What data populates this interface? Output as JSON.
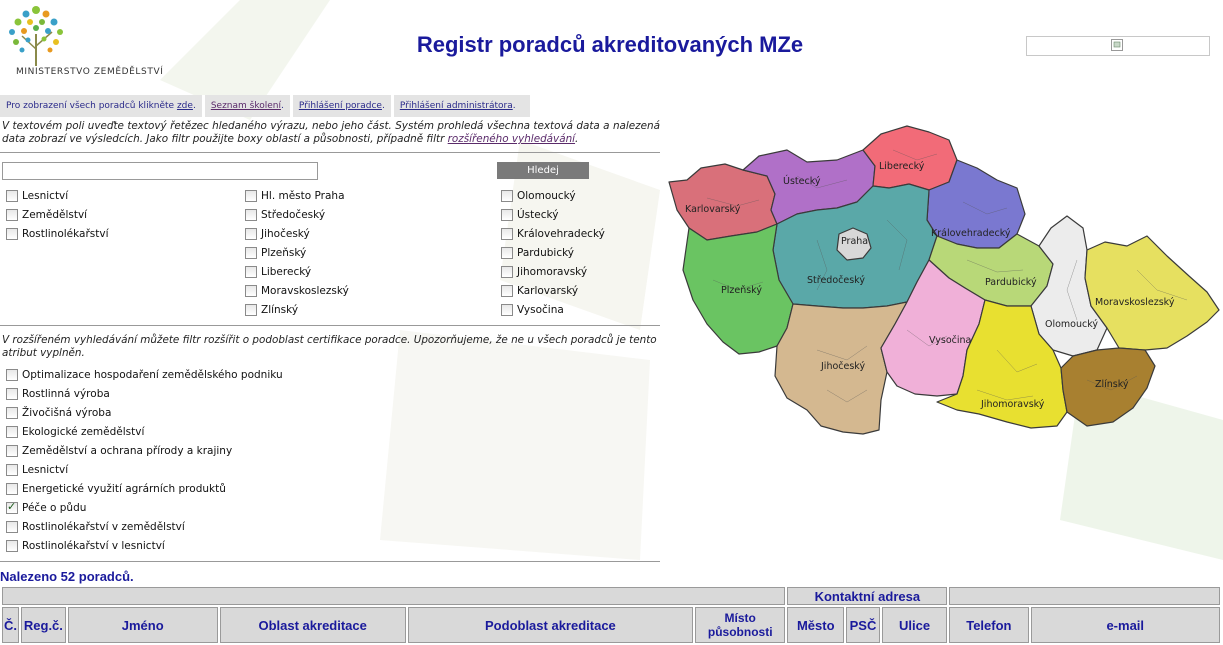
{
  "header": {
    "title": "Registr poradců akreditovaných MZe",
    "logo_text": "MINISTERSTVO ZEMĚDĚLSTVÍ"
  },
  "nav": {
    "all_prefix": "Pro zobrazení všech poradců klikněte ",
    "all_link": "zde",
    "training": "Seznam školení",
    "advisor_login": "Přihlášení poradce",
    "admin_login": "Přihlášení administrátora",
    "dot": "."
  },
  "intro": {
    "text": "V textovém poli uveďte textový řetězec hledaného výrazu, nebo jeho část. Systém prohledá všechna textová data a nalezená data zobrazí ve výsledcích. Jako filtr použijte boxy oblastí a působnosti, případně filtr ",
    "link": "rozšířeného vyhledávání",
    "suffix": "."
  },
  "search": {
    "value": "",
    "button": "Hledej"
  },
  "areas": [
    "Lesnictví",
    "Zemědělství",
    "Rostlinolékařství"
  ],
  "regions_col1": [
    "Hl. město Praha",
    "Středočeský",
    "Jihočeský",
    "Plzeňský",
    "Liberecký",
    "Moravskoslezský",
    "Zlínský"
  ],
  "regions_col2": [
    "Olomoucký",
    "Ústecký",
    "Královehradecký",
    "Pardubický",
    "Jihomoravský",
    "Karlovarský",
    "Vysočina"
  ],
  "extended": {
    "info": "V rozšířeném vyhledávání můžete filtr rozšířit o podoblast certifikace poradce. Upozorňujeme, že ne u všech poradců je tento atribut vyplněn.",
    "subareas": [
      {
        "label": "Optimalizace hospodaření zemědělského podniku",
        "checked": false
      },
      {
        "label": "Rostlinná výroba",
        "checked": false
      },
      {
        "label": "Živočišná výroba",
        "checked": false
      },
      {
        "label": "Ekologické zemědělství",
        "checked": false
      },
      {
        "label": "Zemědělství a ochrana přírody a krajiny",
        "checked": false
      },
      {
        "label": "Lesnictví",
        "checked": false
      },
      {
        "label": "Energetické využití agrárních produktů",
        "checked": false
      },
      {
        "label": "Péče o půdu",
        "checked": true
      },
      {
        "label": "Rostlinolékařství v zemědělství",
        "checked": false
      },
      {
        "label": "Rostlinolékařství v lesnictví",
        "checked": false
      }
    ]
  },
  "results": {
    "count_text": "Nalezeno 52 poradců.",
    "group_header": "Kontaktní adresa",
    "columns": [
      "Č.",
      "Reg.č.",
      "Jméno",
      "Oblast akreditace",
      "Podoblast akreditace",
      "Místo působnosti",
      "Město",
      "PSČ",
      "Ulice",
      "Telefon",
      "e-mail"
    ]
  },
  "map_labels": {
    "liberecky": "Liberecký",
    "ustecky": "Ústecký",
    "karlovarsky": "Karlovarský",
    "praha": "Praha",
    "kralovehradecky": "Královehradecký",
    "stredocesky": "Středočeský",
    "plzensky": "Plzeňský",
    "pardubicky": "Pardubický",
    "moravskoslezsky": "Moravskoslezský",
    "olomoucky": "Olomoucký",
    "vysocina": "Vysočina",
    "jihocesky": "Jihočeský",
    "zlinsky": "Zlínský",
    "jihomoravsky": "Jihomoravský"
  },
  "colors": {
    "title": "#1a1a9c",
    "karlovarsky": "#d9707a",
    "ustecky": "#b070c8",
    "liberecky": "#f26b78",
    "kralovehradecky": "#7a78d0",
    "praha": "#d8d8d8",
    "stredocesky": "#5aa8a8",
    "plzensky": "#6ac462",
    "pardubicky": "#b8d878",
    "olomoucky": "#ececec",
    "moravskoslezsky": "#e6e060",
    "vysocina": "#f0b0d8",
    "jihocesky": "#d4b890",
    "jihomoravsky": "#e8e030",
    "zlinsky": "#a88030"
  }
}
